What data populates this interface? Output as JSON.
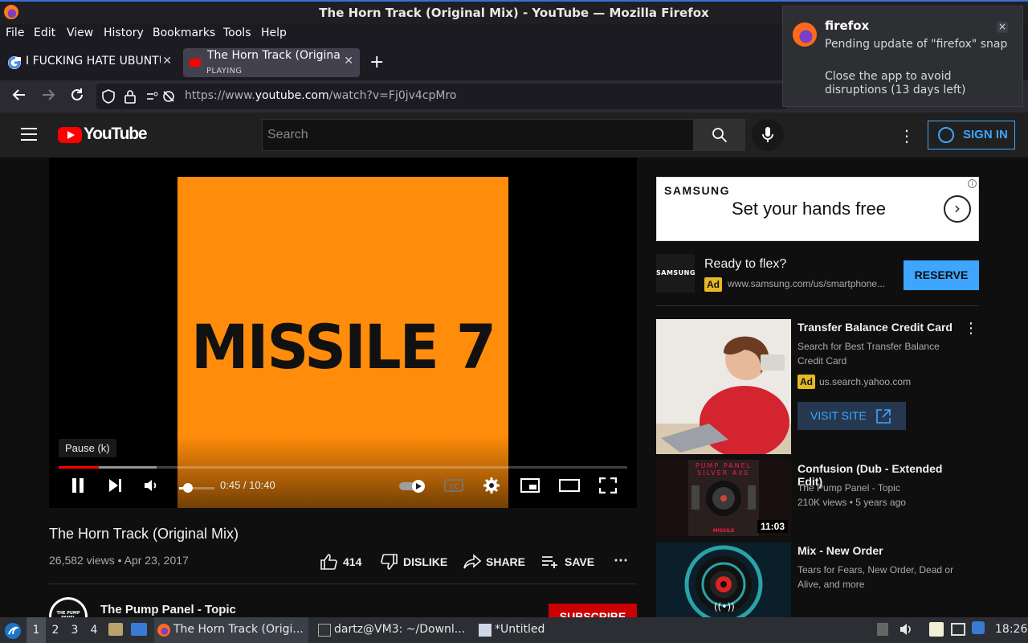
{
  "window": {
    "title": "The Horn Track (Original Mix) - YouTube — Mozilla Firefox"
  },
  "menu": [
    "File",
    "Edit",
    "View",
    "History",
    "Bookmarks",
    "Tools",
    "Help"
  ],
  "tabs": [
    {
      "label": "I FUCKING HATE UBUNTU",
      "status": ""
    },
    {
      "label": "The Horn Track (Original",
      "status": "PLAYING"
    }
  ],
  "url": {
    "prefix": "https://www.",
    "domain": "youtube.com",
    "path": "/watch?v=Fj0jv4cpMro"
  },
  "notification": {
    "app": "firefox",
    "line1": "Pending update of \"firefox\" snap",
    "line2": "Close the app to avoid disruptions (13 days left)"
  },
  "youtube": {
    "logo": "YouTube",
    "search_placeholder": "Search",
    "sign_in": "SIGN IN"
  },
  "player": {
    "album_art_text": "MISSILE 7",
    "tooltip": "Pause (k)",
    "time": "0:45 / 10:40",
    "progress_fraction": 0.0703,
    "buffered_fraction": 0.172,
    "volume_fraction": 0.25
  },
  "video": {
    "title": "The Horn Track (Original Mix)",
    "meta": "26,582 views • Apr 23, 2017",
    "likes": "414",
    "dislike": "DISLIKE",
    "share": "SHARE",
    "save": "SAVE",
    "channel": "The Pump Panel - Topic",
    "channel_avatar_text": "THE PUMP PANEL",
    "subscribe": "SUBSCRIBE"
  },
  "sidebar": {
    "banner": {
      "brand": "SAMSUNG",
      "slogan": "Set your hands free"
    },
    "ad": {
      "logo": "SAMSUNG",
      "headline": "Ready to flex?",
      "badge": "Ad",
      "url": "www.samsung.com/us/smartphone...",
      "cta": "RESERVE"
    },
    "items": [
      {
        "title": "Transfer Balance Credit Card",
        "sub1": "Search for Best Transfer Balance Credit Card",
        "badge": "Ad",
        "sub2": "us.search.yahoo.com",
        "cta": "VISIT SITE"
      },
      {
        "title": "Confusion (Dub - Extended Edit)",
        "sub1": "The Pump Panel - Topic",
        "sub2": "210K views • 5 years ago",
        "duration": "11:03",
        "thumb_top": "PUMP PANEL",
        "thumb_mid": "SILVER AXE",
        "thumb_bottom": "MISSILE"
      },
      {
        "title": "Mix - New Order",
        "sub1": "Tears for Fears, New Order, Dead or Alive, and more"
      }
    ]
  },
  "taskbar": {
    "workspaces": [
      "1",
      "2",
      "3",
      "4"
    ],
    "tasks": [
      "The Horn Track (Origi...",
      "dartz@VM3: ~/Downl...",
      "*Untitled"
    ],
    "clock": "18:26"
  }
}
